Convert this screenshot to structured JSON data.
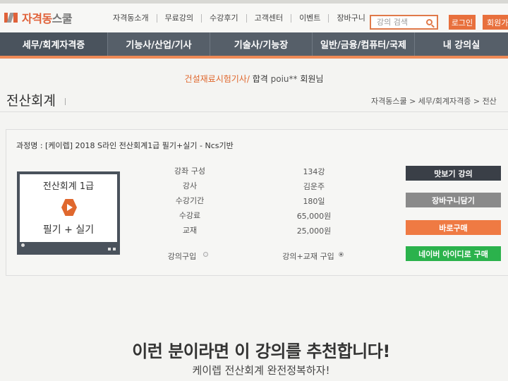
{
  "header": {
    "logo": {
      "brand": "자격동",
      "suffix": "스쿨"
    },
    "nav": [
      "자격동소개",
      "무료강의",
      "수강후기",
      "고객센터",
      "이벤트",
      "장바구니"
    ],
    "search": {
      "placeholder": "강의 검색"
    },
    "login": "로그인",
    "join": "회원가"
  },
  "main_nav": {
    "tabs": [
      {
        "label": "세무/회계자격증",
        "active": true
      },
      {
        "label": "기능사/산업/기사",
        "active": false
      },
      {
        "label": "기술사/기능장",
        "active": false
      },
      {
        "label": "일반/금융/컴퓨터/국제",
        "active": false
      },
      {
        "label": "내 강의실",
        "active": false
      }
    ],
    "accent_color": "#ef8a57",
    "background_color": "#565f69"
  },
  "notice": {
    "highlight": "건설재료시험기사/",
    "text": " 합격 ",
    "user": "poiu**",
    "suffix": " 회원님"
  },
  "page": {
    "title": "전산회계",
    "breadcrumb": "자격동스쿨 > 세무/회계자격증 > 전산"
  },
  "course": {
    "name": "과정명 : [케이렙] 2018 S라인 전산회계1급 필기+실기 - Ncs기반",
    "thumbnail": {
      "title": "전산회계 1급",
      "subtitle": "필기 + 실기"
    },
    "info": [
      {
        "label": "강좌 구성",
        "value": "134강"
      },
      {
        "label": "강사",
        "value": "김운주"
      },
      {
        "label": "수강기간",
        "value": "180일"
      },
      {
        "label": "수강료",
        "value": "65,000원"
      },
      {
        "label": "교재",
        "value": "25,000원"
      }
    ],
    "options": [
      {
        "label": "강의구입",
        "checked": false
      },
      {
        "label": "강의+교재 구입",
        "checked": true
      }
    ],
    "actions": [
      {
        "label": "맛보기 강의",
        "color": "#3a3f47"
      },
      {
        "label": "장바구니담기",
        "color": "#8a8a8a"
      },
      {
        "label": "바로구매",
        "color": "#ef7a43"
      },
      {
        "label": "네이버 아이디로 구매",
        "color": "#2bb24c"
      }
    ]
  },
  "recommend": {
    "title": "이런 분이라면 이 강의를 추천합니다!",
    "subtitle": "케이렙 전산회계 완전정복하자!"
  }
}
